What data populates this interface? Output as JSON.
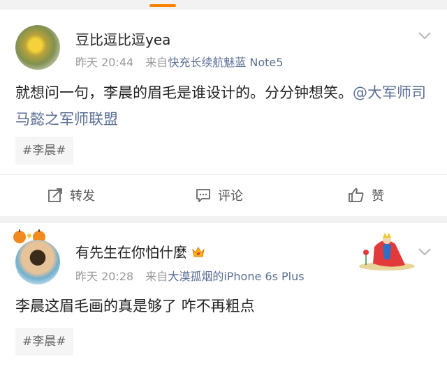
{
  "posts": [
    {
      "username": "豆比逗比逗yea",
      "time": "昨天 20:44",
      "source_prefix": "来自",
      "source": "快充长续航魅蓝 Note5",
      "text": "就想问一句，李晨的眉毛是谁设计的。分分钟想笑。",
      "mention": "@大军师司马懿之军师联盟",
      "tag": "#李晨#",
      "actions": {
        "repost": "转发",
        "comment": "评论",
        "like": "赞"
      }
    },
    {
      "username": "有先生在你怕什麼",
      "time": "昨天 20:28",
      "source_prefix": "来自",
      "source": "大漠孤烟的iPhone 6s Plus",
      "text": "李晨这眉毛画的真是够了 咋不再粗点",
      "tag": "#李晨#"
    }
  ],
  "colors": {
    "accent": "#ff8200",
    "link": "#5b6f95",
    "meta": "#999999"
  }
}
